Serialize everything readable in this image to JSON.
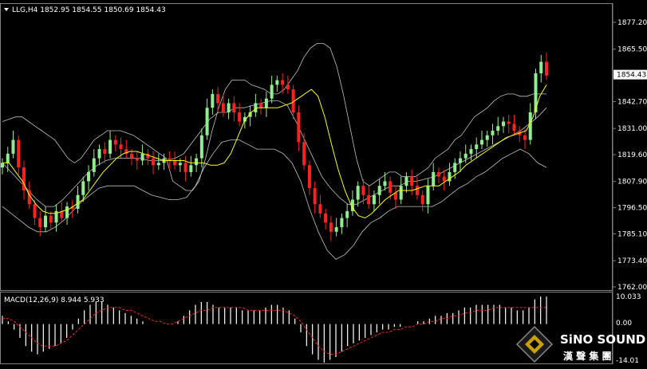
{
  "header": {
    "symbol_line": "LLG,H4  1852.95 1854.55 1850.69 1854.43"
  },
  "macd": {
    "label": "MACD(12,26,9) 8.944 5.933",
    "tick_labels": [
      "10.033",
      "0.00",
      "-14.01"
    ]
  },
  "price_axis": {
    "tick_labels": [
      "1877.20",
      "1865.50",
      "1854.43",
      "1842.70",
      "1831.00",
      "1819.60",
      "1807.90",
      "1796.50",
      "1785.10",
      "1773.40",
      "1762.00"
    ],
    "current_price": "1854.43"
  },
  "brand": {
    "name": "SiNO SOUND",
    "chinese": "漢 聲 集 團"
  },
  "colors": {
    "background": "#000000",
    "bull": "#90ee90",
    "bear": "#ff2020",
    "bollinger": "#c0c0c0",
    "ma_fast": "#ffff00",
    "signal": "#ff2020",
    "histogram": "#ffffff"
  },
  "chart_data": [
    {
      "type": "candlestick",
      "symbol": "LLG",
      "timeframe": "H4",
      "ylim": [
        1762.0,
        1881.0
      ],
      "yticks": [
        1877.2,
        1865.5,
        1854.43,
        1842.7,
        1831.0,
        1819.6,
        1807.9,
        1796.5,
        1785.1,
        1773.4,
        1762.0
      ],
      "close": [
        1816,
        1820,
        1826,
        1814,
        1804,
        1798,
        1792,
        1788,
        1793,
        1790,
        1795,
        1792,
        1797,
        1796,
        1802,
        1808,
        1812,
        1818,
        1822,
        1820,
        1826,
        1824,
        1822,
        1820,
        1818,
        1817,
        1820,
        1818,
        1815,
        1816,
        1818,
        1817,
        1815,
        1816,
        1812,
        1815,
        1818,
        1828,
        1840,
        1846,
        1842,
        1838,
        1842,
        1838,
        1834,
        1836,
        1838,
        1842,
        1840,
        1844,
        1850,
        1852,
        1850,
        1848,
        1838,
        1825,
        1815,
        1805,
        1798,
        1794,
        1790,
        1786,
        1788,
        1792,
        1795,
        1800,
        1806,
        1802,
        1798,
        1802,
        1806,
        1808,
        1803,
        1800,
        1806,
        1810,
        1806,
        1802,
        1798,
        1806,
        1812,
        1810,
        1808,
        1812,
        1816,
        1818,
        1820,
        1822,
        1824,
        1826,
        1828,
        1830,
        1832,
        1834,
        1833,
        1830,
        1828,
        1826,
        1838,
        1855,
        1860,
        1854
      ],
      "upper_band": [
        1834,
        1835,
        1836,
        1836,
        1834,
        1832,
        1830,
        1828,
        1826,
        1822,
        1818,
        1816,
        1818,
        1822,
        1826,
        1828,
        1830,
        1830,
        1830,
        1829,
        1828,
        1826,
        1824,
        1822,
        1820,
        1818,
        1808,
        1806,
        1804,
        1804,
        1808,
        1818,
        1830,
        1840,
        1848,
        1852,
        1852,
        1852,
        1850,
        1849,
        1848,
        1846,
        1846,
        1848,
        1852,
        1856,
        1862,
        1866,
        1868,
        1868,
        1866,
        1858,
        1846,
        1832,
        1818,
        1808,
        1806,
        1808,
        1810,
        1812,
        1812,
        1810,
        1810,
        1810,
        1812,
        1814,
        1818,
        1820,
        1822,
        1826,
        1828,
        1832,
        1836,
        1838,
        1840,
        1843,
        1845,
        1846,
        1846,
        1845,
        1845,
        1846,
        1846,
        1846
      ],
      "middle_band": [
        1816,
        1812,
        1808,
        1804,
        1800,
        1797,
        1797,
        1800,
        1804,
        1808,
        1812,
        1815,
        1817,
        1818,
        1818,
        1818,
        1818,
        1817,
        1817,
        1817,
        1818,
        1820,
        1825,
        1830,
        1835,
        1838,
        1838,
        1840,
        1840,
        1841,
        1842,
        1843,
        1843,
        1841,
        1834,
        1826,
        1818,
        1810,
        1805,
        1801,
        1798,
        1798,
        1800,
        1802,
        1804,
        1806,
        1806,
        1808,
        1808,
        1809,
        1810,
        1812,
        1814,
        1816,
        1818,
        1820,
        1822,
        1824,
        1826,
        1828,
        1830,
        1833,
        1836,
        1840
      ],
      "lower_band": [
        1797,
        1794,
        1791,
        1788,
        1786,
        1786,
        1788,
        1791,
        1795,
        1799,
        1802,
        1805,
        1806,
        1806,
        1806,
        1806,
        1804,
        1802,
        1801,
        1800,
        1800,
        1801,
        1806,
        1814,
        1820,
        1825,
        1826,
        1826,
        1824,
        1822,
        1822,
        1822,
        1820,
        1816,
        1808,
        1796,
        1786,
        1778,
        1774,
        1776,
        1780,
        1786,
        1790,
        1792,
        1795,
        1797,
        1797,
        1797,
        1797,
        1797,
        1799,
        1802,
        1805,
        1807,
        1810,
        1812,
        1815,
        1818,
        1820,
        1822,
        1820,
        1816,
        1814
      ],
      "moving_average": [
        1816,
        1816,
        1812,
        1808,
        1802,
        1798,
        1795,
        1794,
        1794,
        1795,
        1796,
        1798,
        1800,
        1804,
        1808,
        1812,
        1815,
        1818,
        1820,
        1821,
        1821,
        1820,
        1819,
        1818,
        1817,
        1817,
        1817,
        1817,
        1816,
        1816,
        1816,
        1815,
        1815,
        1816,
        1820,
        1827,
        1834,
        1838,
        1840,
        1840,
        1840,
        1840,
        1841,
        1842,
        1844,
        1846,
        1848,
        1845,
        1836,
        1824,
        1813,
        1804,
        1797,
        1793,
        1792,
        1794,
        1797,
        1800,
        1802,
        1804,
        1804,
        1804,
        1805,
        1806,
        1806,
        1806,
        1808,
        1810,
        1812,
        1815,
        1817,
        1819,
        1821,
        1823,
        1825,
        1827,
        1828,
        1829,
        1830,
        1836,
        1845,
        1850
      ]
    },
    {
      "type": "macd",
      "label": "MACD(12,26,9)",
      "macd_value": 8.944,
      "signal_value": 5.933,
      "ylim": [
        -14.01,
        10.033
      ],
      "histogram": [
        3,
        1,
        -2,
        -5,
        -8,
        -10,
        -11,
        -10,
        -9,
        -8,
        -7,
        -5,
        -2,
        2,
        5,
        7,
        8,
        8,
        7,
        6,
        5,
        4,
        3,
        2,
        1,
        0,
        0,
        0,
        0,
        0,
        1,
        3,
        5,
        7,
        8,
        8,
        7,
        6,
        6,
        6,
        6,
        5,
        5,
        5,
        5,
        6,
        7,
        7,
        6,
        5,
        2,
        -3,
        -8,
        -11,
        -13,
        -14,
        -13,
        -12,
        -10,
        -8,
        -7,
        -6,
        -5,
        -4,
        -3,
        -2,
        -2,
        -1,
        -1,
        0,
        0,
        1,
        1,
        2,
        3,
        3,
        4,
        4,
        5,
        6,
        6,
        7,
        7,
        7,
        7,
        7,
        6,
        6,
        5,
        5,
        6,
        9,
        10,
        10
      ],
      "signal": [
        2,
        2,
        1,
        -1,
        -3,
        -5,
        -7,
        -8,
        -8,
        -8,
        -7,
        -6,
        -4,
        -2,
        0,
        2,
        4,
        5,
        6,
        6,
        6,
        5,
        5,
        4,
        3,
        2,
        1,
        1,
        0,
        0,
        1,
        2,
        3,
        4,
        5,
        5,
        6,
        6,
        6,
        6,
        6,
        6,
        5,
        5,
        5,
        5,
        5,
        5,
        5,
        4,
        3,
        1,
        -2,
        -5,
        -8,
        -10,
        -11,
        -11,
        -10,
        -9,
        -8,
        -7,
        -6,
        -5,
        -4,
        -3,
        -3,
        -2,
        -2,
        -1,
        -1,
        0,
        0,
        1,
        1,
        2,
        2,
        3,
        3,
        4,
        4,
        5,
        5,
        5,
        6,
        6,
        6,
        6,
        6,
        6,
        6,
        6,
        6,
        6
      ]
    }
  ]
}
